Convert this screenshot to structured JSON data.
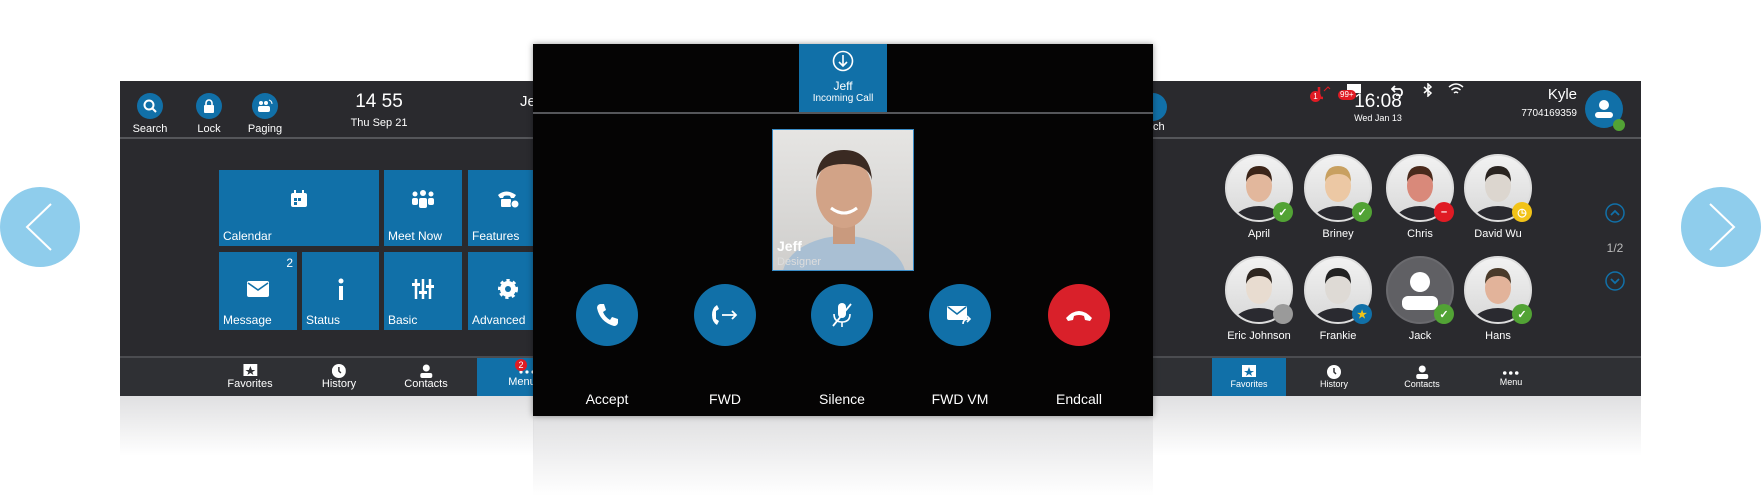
{
  "nav": {
    "prev_icon": "chevron-left-icon",
    "next_icon": "chevron-right-icon"
  },
  "colors": {
    "accent": "#1170a8",
    "end_call": "#d9202a",
    "online": "#52a335",
    "busy": "#e01b24",
    "away": "#f2c318",
    "offline": "#9a9a9a",
    "arrow": "#8fcdec"
  },
  "left_screen": {
    "header": {
      "buttons": [
        {
          "label": "Search",
          "icon": "search-icon"
        },
        {
          "label": "Lock",
          "icon": "lock-icon"
        },
        {
          "label": "Paging",
          "icon": "paging-icon"
        }
      ],
      "time": "14 55",
      "date": "Thu Sep 21",
      "user_partial": "Je"
    },
    "tiles": [
      {
        "label": "Calendar",
        "icon": "calendar-icon"
      },
      {
        "label": "Meet Now",
        "icon": "group-icon"
      },
      {
        "label": "Features",
        "icon": "phone-gear-icon"
      },
      {
        "label": "Message",
        "icon": "envelope-icon",
        "badge": "2"
      },
      {
        "label": "Status",
        "icon": "info-icon"
      },
      {
        "label": "Basic",
        "icon": "sliders-icon"
      },
      {
        "label": "Advanced",
        "icon": "gear-icon"
      }
    ],
    "tabs": [
      {
        "label": "Favorites"
      },
      {
        "label": "History"
      },
      {
        "label": "Contacts"
      },
      {
        "label": "Menu",
        "badge": "2",
        "active": true
      }
    ]
  },
  "center_screen": {
    "top_tab": {
      "name": "Jeff",
      "status": "Incoming Call"
    },
    "caller": {
      "name": "Jeff",
      "title": "Designer"
    },
    "actions": [
      {
        "label": "Accept",
        "icon": "phone-icon"
      },
      {
        "label": "FWD",
        "icon": "forward-call-icon"
      },
      {
        "label": "Silence",
        "icon": "mic-off-icon"
      },
      {
        "label": "FWD VM",
        "icon": "voicemail-forward-icon"
      },
      {
        "label": "Endcall",
        "icon": "hang-up-icon"
      }
    ]
  },
  "right_screen": {
    "header": {
      "search_partial": "ch",
      "missed_calls": "1",
      "messages": "99+",
      "time": "16:08",
      "date": "Wed Jan 13",
      "user": "Kyle",
      "number": "7704169359"
    },
    "contacts": [
      {
        "name": "April",
        "status": "online"
      },
      {
        "name": "Briney",
        "status": "online"
      },
      {
        "name": "Chris",
        "status": "busy"
      },
      {
        "name": "David Wu",
        "status": "away"
      },
      {
        "name": "Eric Johnson",
        "status": "offline"
      },
      {
        "name": "Frankie",
        "status": "favorite"
      },
      {
        "name": "Jack",
        "status": "online"
      },
      {
        "name": "Hans",
        "status": "online"
      }
    ],
    "page": "1/2",
    "tabs": [
      {
        "label": "Favorites",
        "active": true
      },
      {
        "label": "History"
      },
      {
        "label": "Contacts"
      },
      {
        "label": "Menu"
      }
    ]
  }
}
